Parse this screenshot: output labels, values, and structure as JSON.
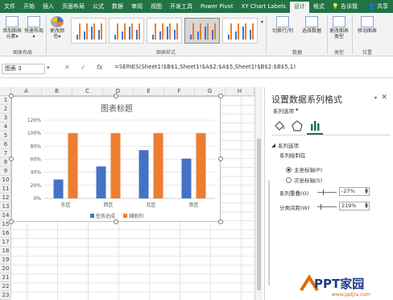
{
  "tabs": [
    "文件",
    "开始",
    "插入",
    "页面布局",
    "公式",
    "数据",
    "审阅",
    "视图",
    "开发工具",
    "Power Pivot",
    "XY Chart Labels",
    "设计",
    "格式"
  ],
  "active_tab": "设计",
  "tell_me": "告诉我",
  "share": "共享",
  "ribbon": {
    "add_chart_element": "添加图表元素▾",
    "quick_layout": "快速布局▾",
    "change_colors": "更改颜色▾",
    "switch_row_col": "切换行/列",
    "select_data": "选择数据",
    "change_chart_type": "更改图表类型",
    "move_chart": "移动图表",
    "groups": {
      "layouts": "图表布局",
      "styles": "图表样式",
      "data": "数据",
      "type": "类型",
      "location": "位置"
    }
  },
  "name_box": "图表 3",
  "formula": "=SERIES(Sheet1!$B$1,Sheet1!$A$2:$A$5,Sheet1!$B$2:$B$5,1)",
  "columns": [
    "A",
    "B",
    "C",
    "D",
    "E",
    "F",
    "G",
    "H"
  ],
  "rows": [
    "1",
    "2",
    "3",
    "4",
    "5",
    "6",
    "7",
    "8",
    "9",
    "10",
    "11",
    "12",
    "13",
    "14",
    "15",
    "16",
    "17",
    "18",
    "19",
    "20",
    "21",
    "22",
    "23"
  ],
  "colors": {
    "series1": "#4472c4",
    "series2": "#ed7d31",
    "excel_green": "#217346"
  },
  "chart_data": {
    "type": "bar",
    "title": "图表标题",
    "categories": [
      "东区",
      "西区",
      "北区",
      "南区"
    ],
    "series": [
      {
        "name": "任务达成",
        "values": [
          0.29,
          0.49,
          0.74,
          0.61
        ]
      },
      {
        "name": "辅助列",
        "values": [
          1.0,
          1.0,
          1.0,
          1.0
        ]
      }
    ],
    "ylim": [
      0,
      1.2
    ],
    "yticks": [
      "0%",
      "20%",
      "40%",
      "60%",
      "80%",
      "100%",
      "120%"
    ],
    "grid": true,
    "legend": "bottom"
  },
  "panel": {
    "title": "设置数据系列格式",
    "subtitle": "系列选项",
    "section": "系列选项",
    "plot_on": "系列绘制在",
    "primary_axis": "主坐标轴(P)",
    "secondary_axis": "次坐标轴(S)",
    "primary_selected": true,
    "overlap_label": "系列重叠(O)",
    "overlap_value": "-27%",
    "gap_label": "分类间距(W)",
    "gap_value": "219%"
  },
  "watermark": {
    "text": "PPT家园",
    "url": "www.pptjia.com"
  }
}
